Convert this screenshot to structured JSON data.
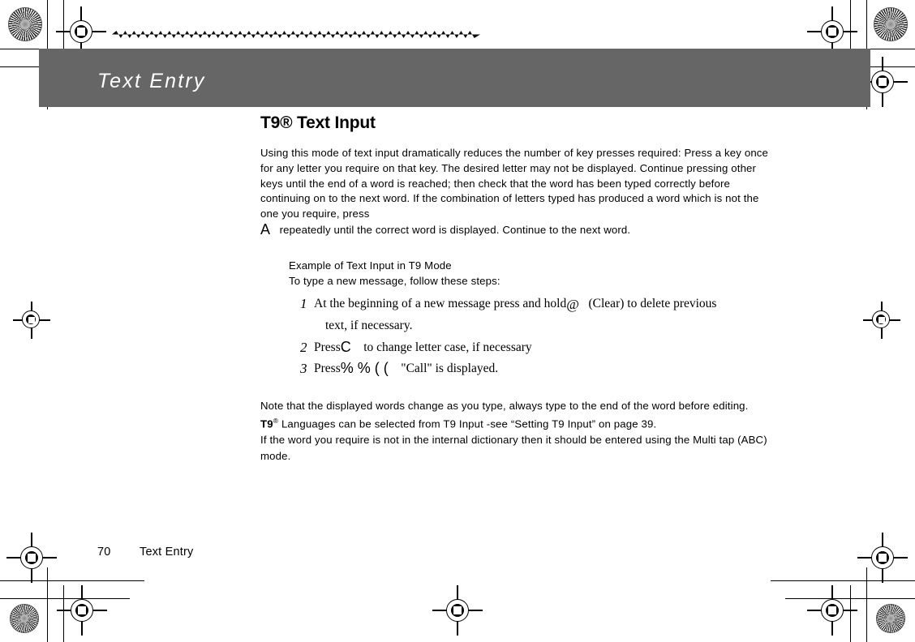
{
  "document": {
    "chapter_header": "Text Entry",
    "section_title": "T9® Text Input",
    "intro_paragraph_a": "Using this mode of text input dramatically reduces the number of key presses required: Press a key once for any letter you require on that key. The desired letter may not be displayed. Continue pressing other keys until the end of a word is reached; then check that the word has been typed correctly before continuing on to the next word. If the combination of letters typed has produced a word which is not the one you require, press",
    "intro_key_glyph": "A",
    "intro_paragraph_b": "repeatedly until the correct word is displayed. Continue to the next word.",
    "example": {
      "heading": "Example of Text Input in T9 Mode",
      "subheading": "To type a new message, follow these steps:",
      "steps": [
        {
          "number": "1",
          "text_before": "At the beginning of a new message press and hold",
          "key_glyph": "@",
          "text_after": "(Clear) to delete previous",
          "continuation": "text, if necessary."
        },
        {
          "number": "2",
          "text_before": "Press",
          "key_glyph": "C",
          "text_after": "to change letter case, if necessary",
          "continuation": ""
        },
        {
          "number": "3",
          "text_before": "Press",
          "key_glyph": "%   %   (     (",
          "text_after": "\"Call\" is displayed.",
          "continuation": ""
        }
      ]
    },
    "notes": [
      "Note that the displayed words change as you type, always type to the end of the word before editing.",
      "Languages can be selected from T9 Input -see “Setting T9 Input” on page 39.",
      "If the word you require is not in the internal dictionary then it should be entered using the Multi tap (ABC) mode."
    ],
    "note_t9_mark": "T9",
    "note_t9_sup": "®",
    "footer": {
      "page_number": "70",
      "chapter_label": "Text Entry"
    },
    "colors": {
      "header_band": "#666666",
      "header_text": "#ffffff",
      "body_text": "#000000",
      "page_background": "#ffffff"
    }
  }
}
